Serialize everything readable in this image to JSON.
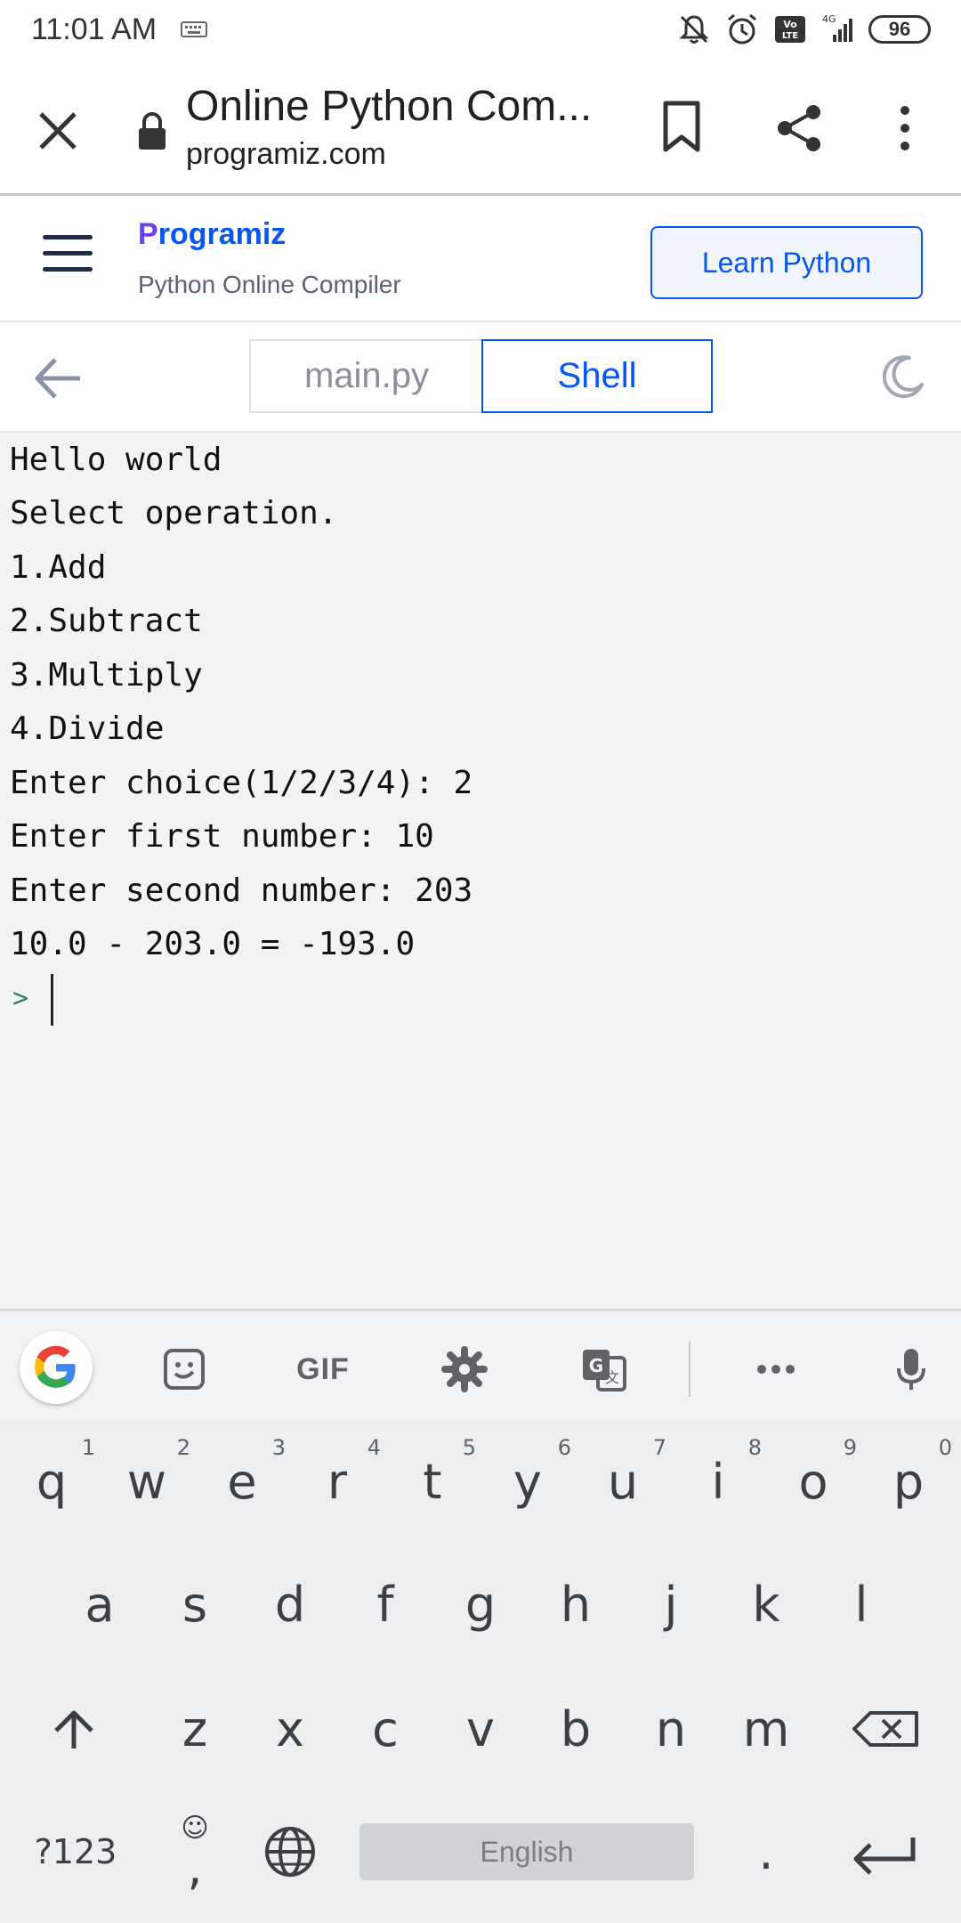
{
  "status_bar": {
    "time": "11:01 AM",
    "network": "4G",
    "volte": "Vo LTE",
    "battery": "96"
  },
  "browser": {
    "title": "Online Python Com...",
    "domain": "programiz.com"
  },
  "site": {
    "brand_first": "P",
    "brand_rest": "rogramiz",
    "subtitle": "Python Online Compiler",
    "cta_label": "Learn Python"
  },
  "editor": {
    "tabs": [
      {
        "label": "main.py",
        "active": false
      },
      {
        "label": "Shell",
        "active": true
      }
    ]
  },
  "shell": {
    "lines": [
      "Hello world",
      "Select operation.",
      "1.Add",
      "2.Subtract",
      "3.Multiply",
      "4.Divide",
      "Enter choice(1/2/3/4): 2",
      "Enter first number: 10",
      "Enter second number: 203",
      "10.0 - 203.0 = -193.0"
    ],
    "prompt": ">"
  },
  "keyboard": {
    "toolbar": {
      "gif_label": "GIF"
    },
    "row1": [
      {
        "key": "q",
        "hint": "1"
      },
      {
        "key": "w",
        "hint": "2"
      },
      {
        "key": "e",
        "hint": "3"
      },
      {
        "key": "r",
        "hint": "4"
      },
      {
        "key": "t",
        "hint": "5"
      },
      {
        "key": "y",
        "hint": "6"
      },
      {
        "key": "u",
        "hint": "7"
      },
      {
        "key": "i",
        "hint": "8"
      },
      {
        "key": "o",
        "hint": "9"
      },
      {
        "key": "p",
        "hint": "0"
      }
    ],
    "row2": [
      "a",
      "s",
      "d",
      "f",
      "g",
      "h",
      "j",
      "k",
      "l"
    ],
    "row3": [
      "z",
      "x",
      "c",
      "v",
      "b",
      "n",
      "m"
    ],
    "symbols_label": "?123",
    "comma_label": ",",
    "period_label": ".",
    "space_label": "English",
    "accent_color": "#0556f3"
  }
}
